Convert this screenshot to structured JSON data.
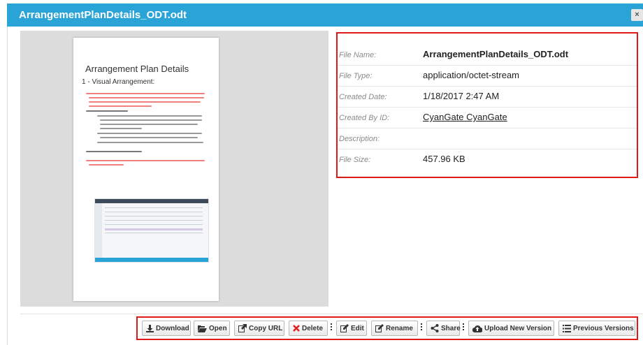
{
  "header": {
    "title": "ArrangementPlanDetails_ODT.odt",
    "close_glyph": "×"
  },
  "preview": {
    "doc_title": "Arrangement Plan Details",
    "doc_subtitle": "1 - Visual Arrangement:"
  },
  "details": [
    {
      "label": "File Name:",
      "value": "ArrangementPlanDetails_ODT.odt",
      "style": "bold"
    },
    {
      "label": "File Type:",
      "value": "application/octet-stream",
      "style": "normal"
    },
    {
      "label": "Created Date:",
      "value": "1/18/2017 2:47 AM",
      "style": "normal"
    },
    {
      "label": "Created By ID:",
      "value": "CyanGate CyanGate",
      "style": "link"
    },
    {
      "label": "Description:",
      "value": "",
      "style": "normal"
    },
    {
      "label": "File Size:",
      "value": "457.96 KB",
      "style": "normal"
    }
  ],
  "toolbar": {
    "download": "Download",
    "open": "Open",
    "copy_url": "Copy URL",
    "delete": "Delete",
    "edit": "Edit",
    "rename": "Rename",
    "share": "Share",
    "upload_new_version": "Upload New Version",
    "previous_versions": "Previous Versions"
  },
  "colors": {
    "header_bg": "#2aa3d6",
    "highlight_border": "#e01919",
    "delete_icon": "#e02020"
  }
}
